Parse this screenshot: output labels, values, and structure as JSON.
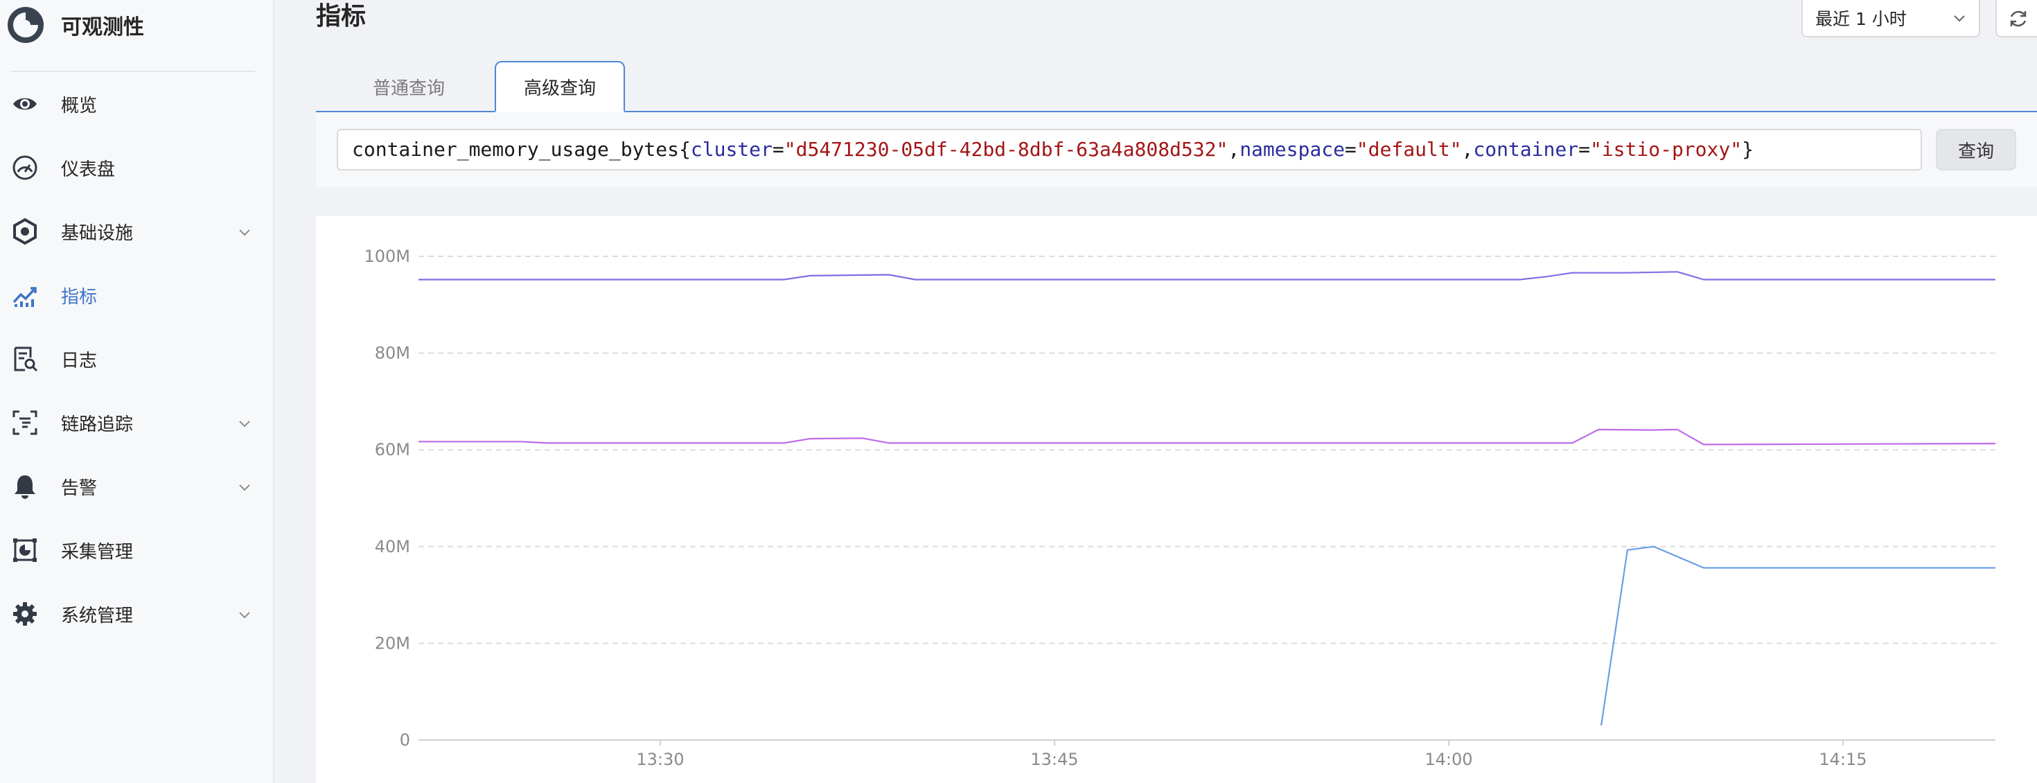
{
  "app": {
    "title": "可观测性"
  },
  "sidebar": {
    "items": [
      {
        "label": "概览",
        "icon": "eye-icon",
        "expandable": false,
        "active": false
      },
      {
        "label": "仪表盘",
        "icon": "dashboard-gauge-icon",
        "expandable": false,
        "active": false
      },
      {
        "label": "基础设施",
        "icon": "hexagon-settings-icon",
        "expandable": true,
        "active": false
      },
      {
        "label": "指标",
        "icon": "line-chart-icon",
        "expandable": false,
        "active": true
      },
      {
        "label": "日志",
        "icon": "document-search-icon",
        "expandable": false,
        "active": false
      },
      {
        "label": "链路追踪",
        "icon": "trace-scan-icon",
        "expandable": true,
        "active": false
      },
      {
        "label": "告警",
        "icon": "bell-icon",
        "expandable": true,
        "active": false
      },
      {
        "label": "采集管理",
        "icon": "collect-chart-icon",
        "expandable": false,
        "active": false
      },
      {
        "label": "系统管理",
        "icon": "gear-icon",
        "expandable": true,
        "active": false
      }
    ]
  },
  "header": {
    "title": "指标",
    "time_range": "最近 1 小时"
  },
  "tabs": [
    {
      "label": "普通查询",
      "active": false
    },
    {
      "label": "高级查询",
      "active": true
    }
  ],
  "query": {
    "metric": "container_memory_usage_bytes",
    "labels": [
      {
        "key": "cluster",
        "value": "\"d5471230-05df-42bd-8dbf-63a4a808d532\""
      },
      {
        "key": "namespace",
        "value": "\"default\""
      },
      {
        "key": "container",
        "value": "\"istio-proxy\""
      }
    ],
    "button_label": "查询"
  },
  "colors": {
    "accent": "#3f74c6",
    "series_1": "#7b6fe6",
    "series_2": "#c06be8",
    "series_3": "#6a9ee6"
  },
  "chart_data": {
    "type": "line",
    "y_ticks": [
      "0",
      "20M",
      "40M",
      "60M",
      "80M",
      "100M"
    ],
    "ylim": [
      0,
      100
    ],
    "y_unit": "M",
    "x_ticks": [
      "13:30",
      "13:45",
      "14:00",
      "14:15"
    ],
    "x_tick_minutes": [
      30,
      45,
      60,
      75
    ],
    "xlim_minutes": [
      20.8,
      80.8
    ],
    "x_origin": "13:00",
    "grid": true,
    "series": [
      {
        "color": "#7b6fe6",
        "x_minutes": [
          20.8,
          34.7,
          35.7,
          38.7,
          39.7,
          62.7,
          63.7,
          64.7,
          66.7,
          68.7,
          69.7,
          80.8
        ],
        "values": [
          95.2,
          95.2,
          96.0,
          96.2,
          95.2,
          95.2,
          95.8,
          96.6,
          96.6,
          96.8,
          95.2,
          95.2
        ]
      },
      {
        "color": "#c06be8",
        "x_minutes": [
          20.8,
          24.7,
          25.7,
          34.7,
          35.7,
          37.7,
          38.7,
          64.7,
          65.7,
          67.7,
          68.7,
          69.7,
          80.8
        ],
        "values": [
          61.7,
          61.7,
          61.4,
          61.4,
          62.3,
          62.4,
          61.4,
          61.4,
          64.2,
          64.1,
          64.2,
          61.1,
          61.3
        ]
      },
      {
        "color": "#6a9ee6",
        "x_minutes": [
          65.8,
          66.8,
          67.8,
          69.7,
          80.8
        ],
        "values": [
          3.0,
          39.3,
          40.0,
          35.6,
          35.6
        ]
      }
    ]
  }
}
